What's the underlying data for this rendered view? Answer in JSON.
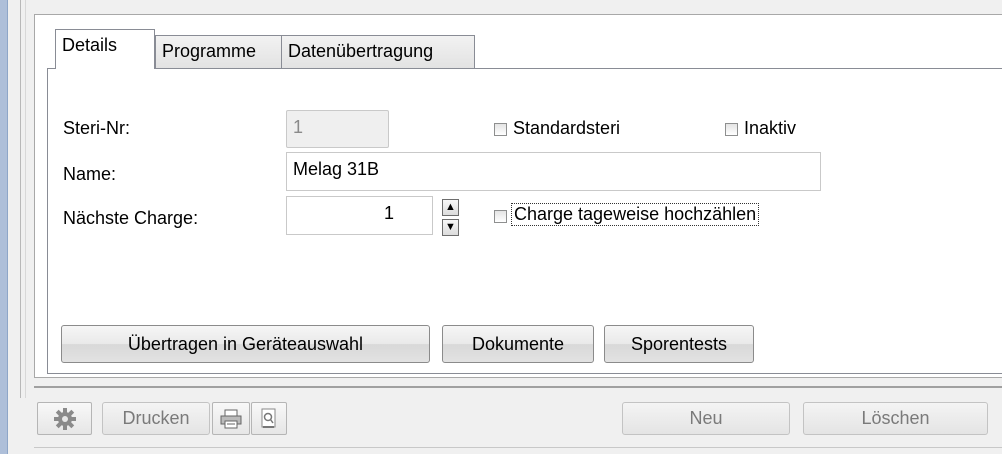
{
  "tabs": [
    {
      "label": "Details"
    },
    {
      "label": "Programme"
    },
    {
      "label": "Datenübertragung"
    }
  ],
  "form": {
    "steri_nr_label": "Steri-Nr:",
    "steri_nr_value": "1",
    "standardsteri_label": "Standardsteri",
    "inaktiv_label": "Inaktiv",
    "name_label": "Name:",
    "name_value": "Melag 31B",
    "next_charge_label": "Nächste Charge:",
    "next_charge_value": "1",
    "charge_daily_label": "Charge tageweise hochzählen"
  },
  "actions": {
    "transfer_label": "Übertragen in Geräteauswahl",
    "documents_label": "Dokumente",
    "spore_tests_label": "Sporentests"
  },
  "toolbar": {
    "print_label": "Drucken",
    "new_label": "Neu",
    "delete_label": "Löschen"
  },
  "icons": {
    "settings": "gear-icon",
    "printer": "printer-icon",
    "print_preview": "print-preview-icon",
    "spin_up": "chevron-up-icon",
    "spin_down": "chevron-down-icon"
  }
}
